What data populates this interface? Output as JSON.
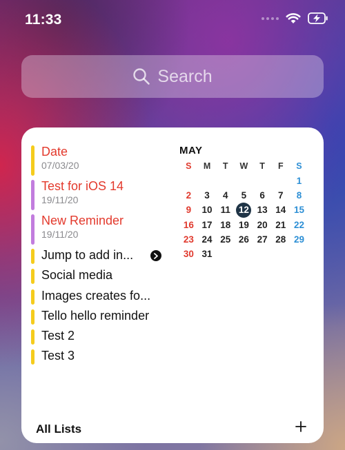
{
  "status_bar": {
    "time": "11:33",
    "icons": [
      "signal-dots-icon",
      "wifi-icon",
      "battery-charging-icon"
    ]
  },
  "search": {
    "placeholder": "Search",
    "icon": "search-icon"
  },
  "widget": {
    "reminders": [
      {
        "title": "Date",
        "subtitle": "07/03/20",
        "style": "red",
        "bar_color": "#f5cc1d"
      },
      {
        "title": "Test for iOS 14",
        "subtitle": "19/11/20",
        "style": "red",
        "bar_color": "#c27dde"
      },
      {
        "title": "New Reminder",
        "subtitle": "19/11/20",
        "style": "red",
        "bar_color": "#c27dde"
      },
      {
        "title": "Jump to add in...",
        "subtitle": "",
        "style": "plain",
        "bar_color": "#f5cc1d",
        "icon": "chevron-right-circle-icon"
      },
      {
        "title": "Social media",
        "subtitle": "",
        "style": "plain",
        "bar_color": "#f5cc1d"
      },
      {
        "title": "Images creates fo...",
        "subtitle": "",
        "style": "plain",
        "bar_color": "#f5cc1d"
      },
      {
        "title": "Tello hello reminder",
        "subtitle": "",
        "style": "plain",
        "bar_color": "#f5cc1d"
      },
      {
        "title": "Test 2",
        "subtitle": "",
        "style": "plain",
        "bar_color": "#f5cc1d"
      },
      {
        "title": "Test 3",
        "subtitle": "",
        "style": "plain",
        "bar_color": "#f5cc1d"
      }
    ],
    "calendar": {
      "month": "MAY",
      "weekdays": [
        "S",
        "M",
        "T",
        "W",
        "T",
        "F",
        "S"
      ],
      "days": [
        "",
        "",
        "",
        "",
        "",
        "",
        "1",
        "2",
        "3",
        "4",
        "5",
        "6",
        "7",
        "8",
        "9",
        "10",
        "11",
        "12",
        "13",
        "14",
        "15",
        "16",
        "17",
        "18",
        "19",
        "20",
        "21",
        "22",
        "23",
        "24",
        "25",
        "26",
        "27",
        "28",
        "29",
        "30",
        "31",
        "",
        "",
        "",
        "",
        ""
      ],
      "today": "12",
      "colors": {
        "sunday": "#e03a2e",
        "saturday": "#2d8fd5",
        "today_bg": "#1f3446"
      }
    },
    "footer": {
      "label": "All Lists",
      "add_icon": "plus-icon"
    }
  }
}
